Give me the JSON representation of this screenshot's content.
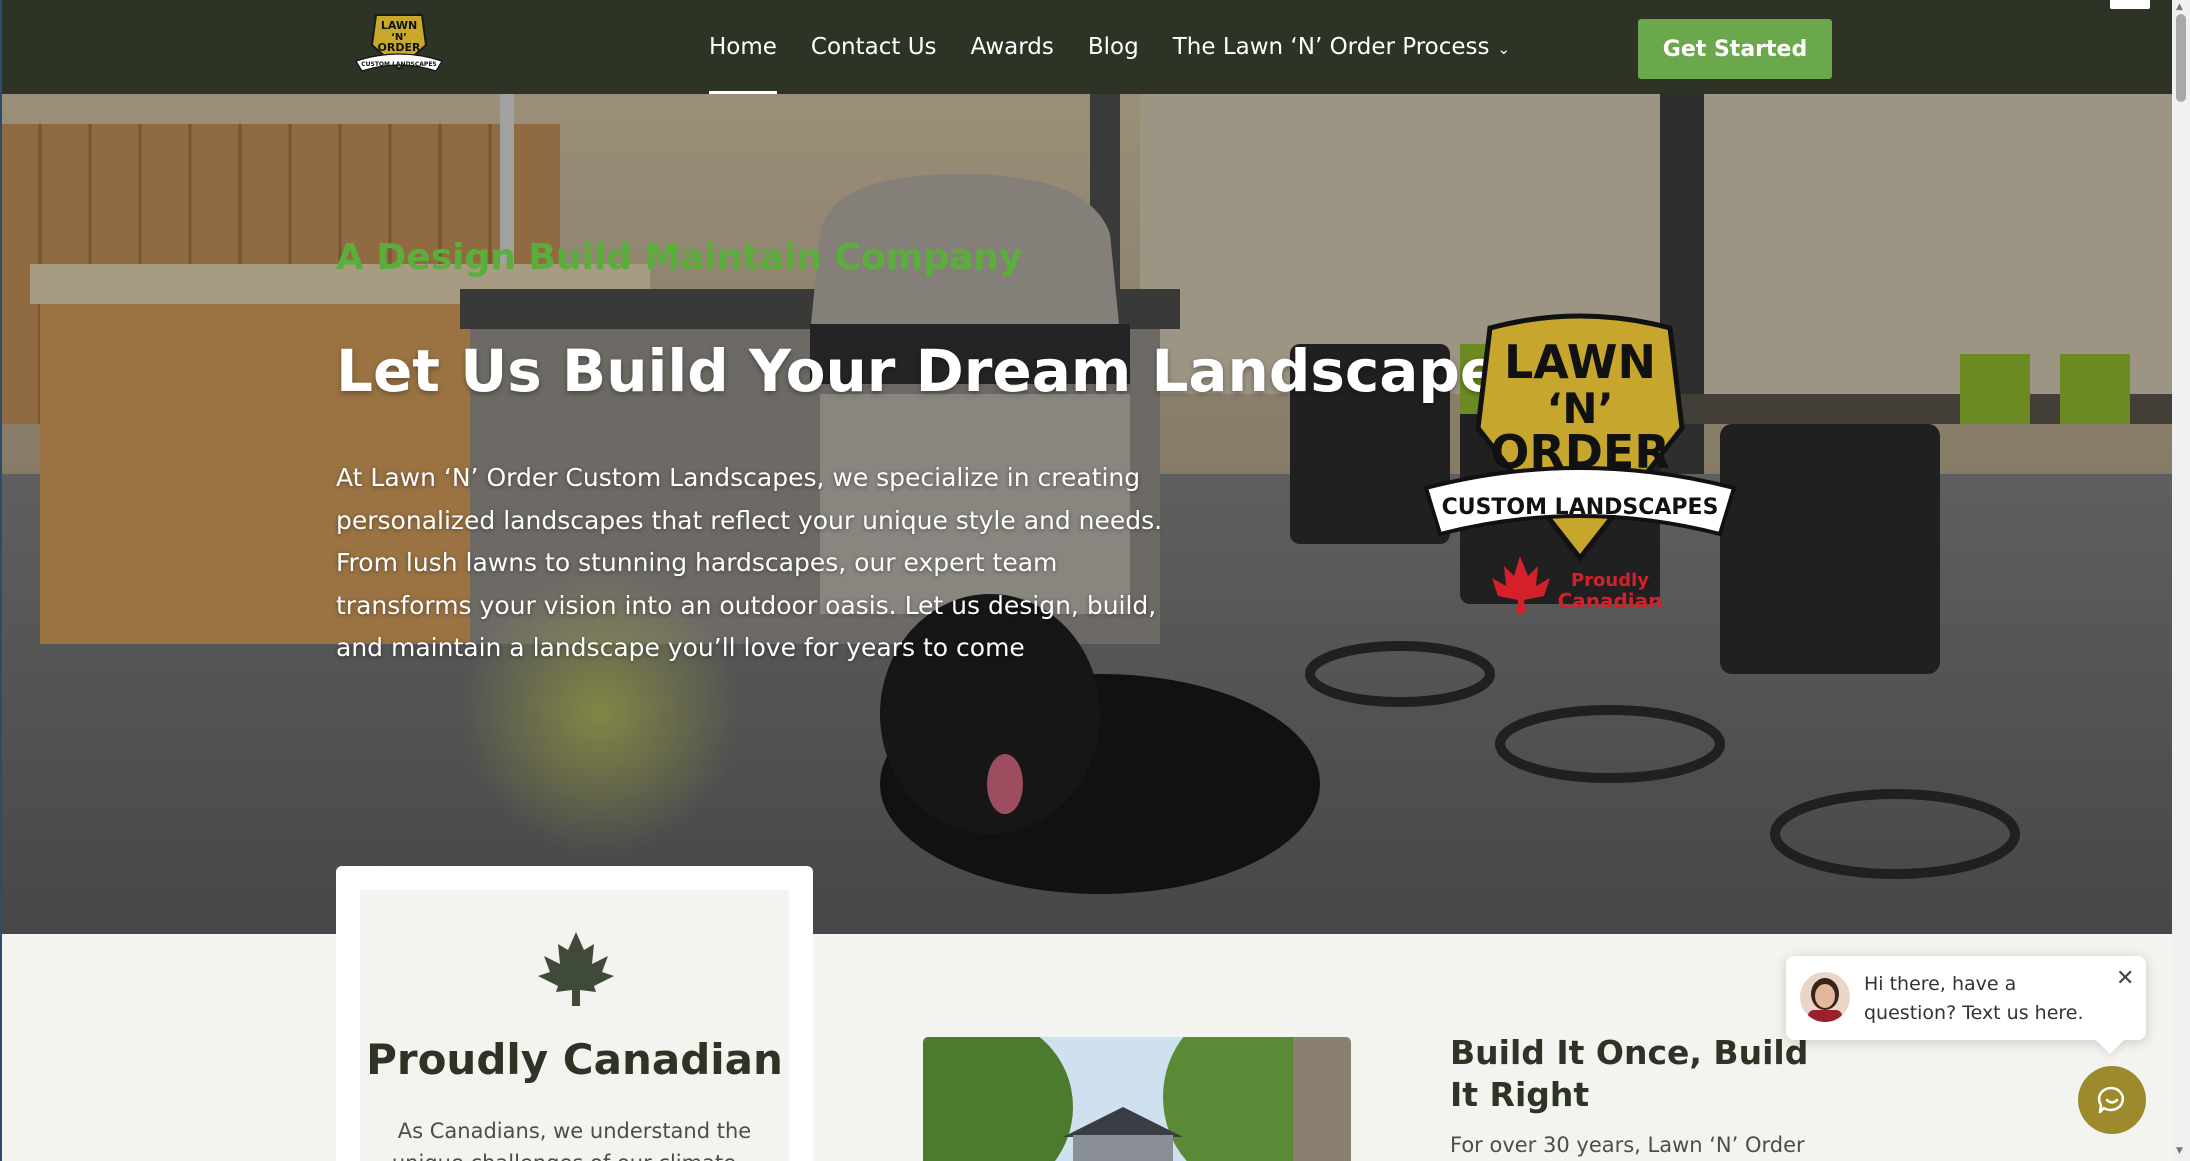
{
  "nav": {
    "logo_text": [
      "LAWN",
      "'N'",
      "ORDER",
      "CUSTOM LANDSCAPES"
    ],
    "links": [
      {
        "label": "Home",
        "active": true
      },
      {
        "label": "Contact Us"
      },
      {
        "label": "Awards"
      },
      {
        "label": "Blog"
      },
      {
        "label": "The Lawn ‘N’ Order Process",
        "has_dropdown": true
      }
    ],
    "cta_label": "Get Started"
  },
  "hero": {
    "tagline": "A Design Build Maintain Company",
    "headline": "Let Us Build Your Dream Landscape",
    "paragraph": "At Lawn ‘N’ Order Custom Landscapes, we specialize in creating personalized landscapes that reflect your unique style and needs. From lush lawns to stunning hardscapes, our expert team transforms your vision into an outdoor oasis. Let us design, build, and maintain a landscape you’ll love for years to come",
    "logo": {
      "line1": "LAWN",
      "line2": "‘N’",
      "line3": "ORDER",
      "banner": "CUSTOM LANDSCAPES",
      "badge_line1": "Proudly",
      "badge_line2": "Canadian"
    }
  },
  "feature_card": {
    "icon": "maple-leaf-icon",
    "title": "Proudly Canadian",
    "text": "As Canadians, we understand the unique challenges of our climate—"
  },
  "section": {
    "title": "Build It Once, Build It Right",
    "text": "For over 30 years, Lawn ‘N’ Order"
  },
  "chat": {
    "message": "Hi there, have a question? Text us here.",
    "close_icon": "close-icon",
    "button_icon": "chat-icon"
  },
  "colors": {
    "nav_bg": "#2d3325",
    "accent_green": "#6ba74b",
    "tagline_green": "#5cae3c",
    "gold": "#c9a92a",
    "chat_button": "#9c8a2c"
  }
}
